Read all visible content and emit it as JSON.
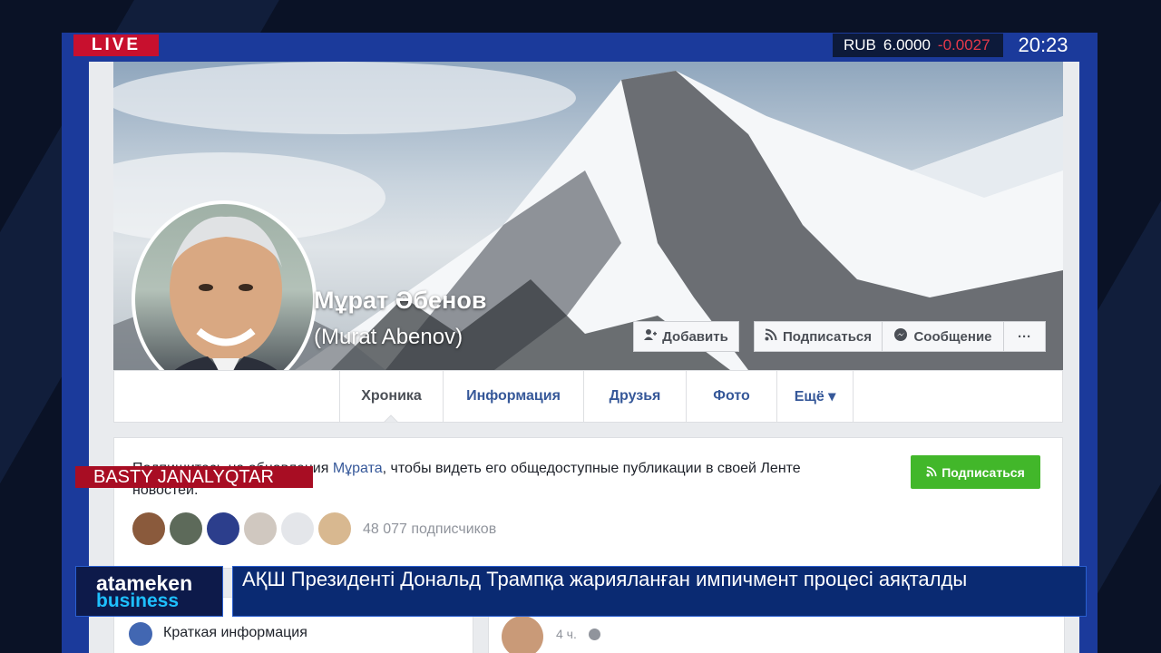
{
  "overlay": {
    "live_label": "LIVE",
    "currency": "RUB",
    "rate": "6.0000",
    "change": "-0.0027",
    "clock": "20:23",
    "section_label": "BASTY JANALYQTAR",
    "logo_line1": "atameken",
    "logo_line2": "business",
    "headline": "АҚШ Президенті Дональд Трампқа жарияланған импичмент процесі аяқталды"
  },
  "profile": {
    "name": "Мұрат Әбенов",
    "alt_name": "(Murat Abenov)",
    "add_button": "Добавить",
    "follow_button": "Подписаться",
    "message_button": "Сообщение",
    "more_button": "···"
  },
  "tabs": [
    {
      "label": "Хроника"
    },
    {
      "label": "Информация"
    },
    {
      "label": "Друзья"
    },
    {
      "label": "Фото"
    },
    {
      "label": "Ещё ▾"
    }
  ],
  "follow_box": {
    "text_before": "Подпишитесь на обновления ",
    "text_link": "Мұрата",
    "text_after": ", чтобы видеть его общедоступные публикации в своей Ленте новостей.",
    "button": "Подписаться",
    "subscriber_count": "48 077 подписчиков"
  },
  "cards": {
    "left_title": "Краткая информация",
    "post_time": "4 ч."
  },
  "colors": {
    "live_red": "#c8102e",
    "frame_blue": "#1b3a9b",
    "fb_link": "#365899",
    "fb_green": "#42b72a"
  }
}
